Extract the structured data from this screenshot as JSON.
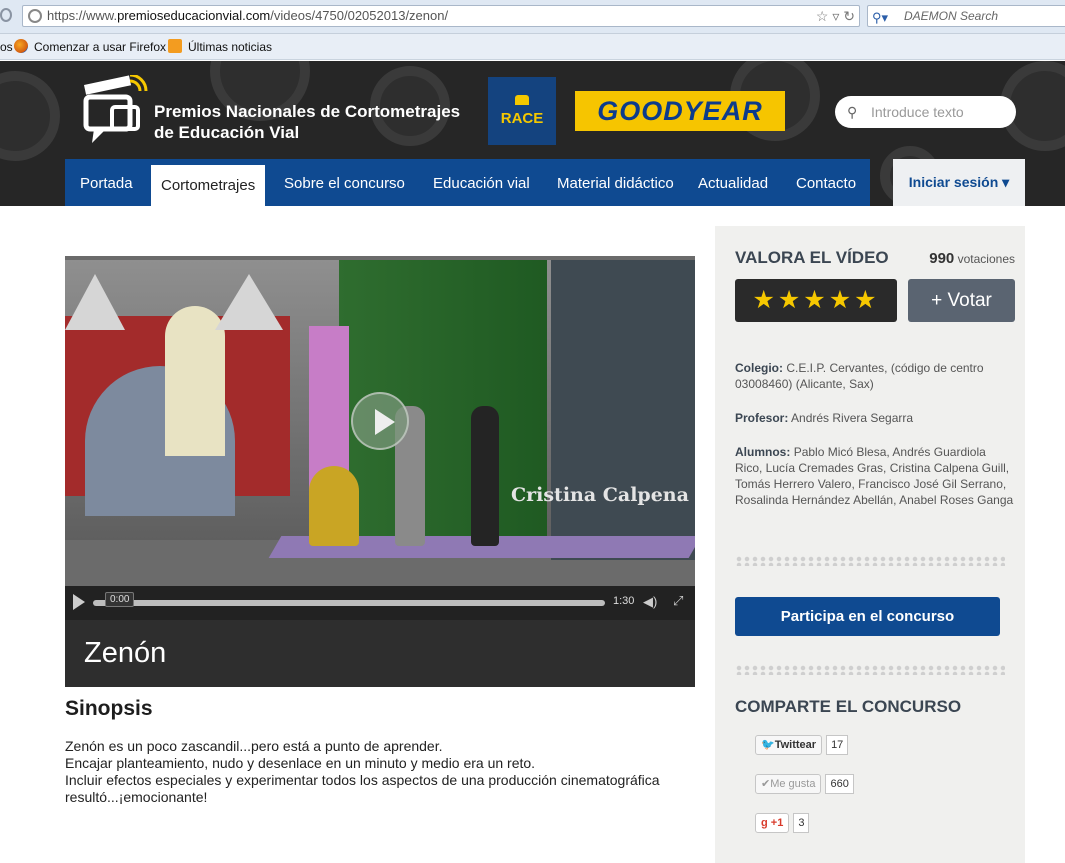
{
  "browser": {
    "url_prefix": "https://www.",
    "url_domain": "premioseducacionvial.com",
    "url_path": "/videos/4750/02052013/zenon/",
    "search_placeholder": "DAEMON Search",
    "bookmarks": [
      {
        "label": "os",
        "icon": "bookmark-stub"
      },
      {
        "label": "Comenzar a usar Firefox",
        "icon": "firefox-icon"
      },
      {
        "label": "Últimas noticias",
        "icon": "rss-icon"
      }
    ]
  },
  "header": {
    "logo_line1": "Premios Nacionales de Cortometrajes",
    "logo_line2": "de Educación Vial",
    "sponsor_race": "RACE",
    "sponsor_goodyear": "GOODYEAR",
    "search_placeholder": "Introduce texto",
    "nav": [
      "Portada",
      "Cortometrajes",
      "Sobre el concurso",
      "Educación vial",
      "Material didáctico",
      "Actualidad",
      "Contacto"
    ],
    "active_nav": "Cortometrajes",
    "login": "Iniciar sesión ▾"
  },
  "video": {
    "caption": "Cristina Calpena",
    "current_time": "0:00",
    "duration": "1:30",
    "title": "Zenón"
  },
  "synopsis": {
    "heading": "Sinopsis",
    "lines": [
      "Zenón es un poco zascandil...pero está a punto de aprender.",
      "Encajar planteamiento, nudo y desenlace en un minuto y medio era un reto.",
      "Incluir efectos especiales y experimentar todos los aspectos de una producción cinematográfica",
      "resultó...¡emocionante!"
    ]
  },
  "sidebar": {
    "valora_title": "VALORA EL VÍDEO",
    "vote_count": "990",
    "vote_label": "votaciones",
    "stars": "★★★★★",
    "vote_button": "+ Votar",
    "colegio_label": "Colegio:",
    "colegio_value": "C.E.I.P. Cervantes, (código de centro 03008460) (Alicante, Sax)",
    "profesor_label": "Profesor:",
    "profesor_value": "Andrés Rivera Segarra",
    "alumnos_label": "Alumnos:",
    "alumnos_value": "Pablo Micó Blesa, Andrés Guardiola Rico, Lucía Cremades Gras, Cristina Calpena Guill, Tomás Herrero Valero, Francisco José Gil Serrano, Rosalinda Hernández Abellán, Anabel Roses Ganga",
    "participa_button": "Participa en el concurso",
    "comparte_title": "COMPARTE EL CONCURSO",
    "share": {
      "twitter_label": "Twittear",
      "twitter_count": "17",
      "like_label": "✔Me gusta",
      "like_count": "660",
      "gplus_label": "g +1",
      "gplus_count": "3"
    }
  },
  "colors": {
    "brand_blue": "#0f4a91",
    "header_dark": "#262626",
    "star_yellow": "#f6c800"
  }
}
